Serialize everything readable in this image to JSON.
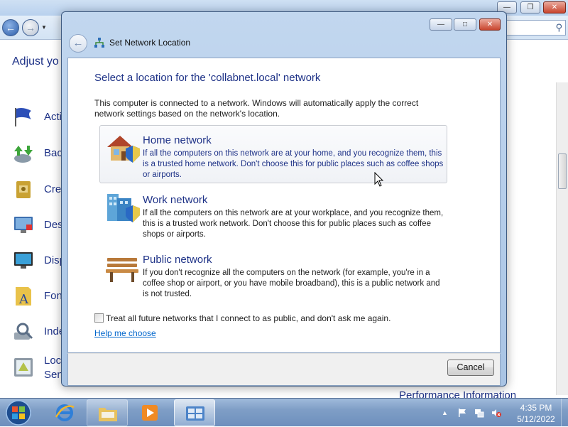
{
  "background_window": {
    "heading": "Adjust yo",
    "items": [
      {
        "label": "Acti",
        "icon": "flag-icon"
      },
      {
        "label": "Bac",
        "icon": "backup-icon"
      },
      {
        "label": "Cre",
        "icon": "credential-icon"
      },
      {
        "label": "Des",
        "icon": "desktop-gadgets-icon"
      },
      {
        "label": "Disp",
        "icon": "display-icon"
      },
      {
        "label": "Fon",
        "icon": "fonts-icon"
      },
      {
        "label": "Inde",
        "icon": "indexing-icon"
      },
      {
        "label": "Loc",
        "icon": "location-icon"
      },
      {
        "label": "Sen",
        "icon": ""
      }
    ],
    "bottom_link": "Performance Information"
  },
  "dialog": {
    "title": "Set Network Location",
    "heading": "Select a location for the 'collabnet.local' network",
    "description": "This computer is connected to a network. Windows will automatically apply the correct network settings based on the network's location.",
    "options": [
      {
        "title": "Home network",
        "description": "If all the computers on this network are at your home, and you recognize them, this is a trusted home network.  Don't choose this for public places such as coffee shops or airports.",
        "icon": "home-network-icon",
        "hovered": true
      },
      {
        "title": "Work network",
        "description": "If all the computers on this network are at your workplace, and you recognize them, this is a trusted work network.  Don't choose this for public places such as coffee shops or airports.",
        "icon": "work-network-icon",
        "hovered": false
      },
      {
        "title": "Public network",
        "description": "If you don't recognize all the computers on the network (for example, you're in a coffee shop or airport, or you have mobile broadband), this is a public network and is not trusted.",
        "icon": "public-network-icon",
        "hovered": false
      }
    ],
    "checkbox": {
      "label": "Treat all future networks that I connect to as public, and don't ask me again.",
      "checked": false
    },
    "help_link": "Help me choose",
    "cancel_label": "Cancel"
  },
  "taskbar": {
    "clock_time": "4:35 PM",
    "clock_date": "5/12/2022"
  },
  "colors": {
    "heading_blue": "#1e3287",
    "link_blue": "#0066cc",
    "taskbar": "#7f9ec6"
  }
}
